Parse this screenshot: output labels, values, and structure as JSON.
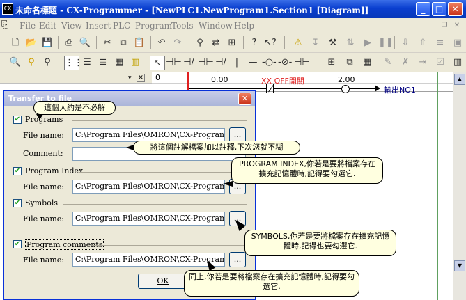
{
  "window": {
    "title": "未命名標題 - CX-Programmer - [NewPLC1.NewProgram1.Section1 [Diagram]]",
    "min": "_",
    "max": "□",
    "close": "✕"
  },
  "menu": [
    "File",
    "Edit",
    "View",
    "Insert",
    "PLC",
    "Program",
    "Tools",
    "Window",
    "Help"
  ],
  "toolbar1_icons": [
    "new-icon",
    "open-icon",
    "save-icon",
    "print-icon",
    "print-preview-icon",
    "cut-icon",
    "copy-icon",
    "paste-icon",
    "undo-icon",
    "redo-icon",
    "find-icon",
    "replace-icon",
    "cross-reference-icon",
    "help-icon",
    "context-help-icon",
    "warning-icon",
    "rung-icon",
    "compile-icon",
    "stop-icon",
    "pause-icon",
    "monitor-icon"
  ],
  "ladder": {
    "address_left": "0.00",
    "contact_label": "XX OFF開關",
    "address_right": "2.00",
    "coil_label": "輸出NO1"
  },
  "dialog": {
    "title": "Transfer to file",
    "close": "✕",
    "sections": [
      {
        "label": "Programs",
        "checked": true,
        "path": "C:\\Program Files\\OMRON\\CX-Programmer\\N",
        "browse": "..."
      },
      {
        "label": "Program Index",
        "checked": true,
        "path": "C:\\Program Files\\OMRON\\CX-Programmer\\P",
        "browse": "..."
      },
      {
        "label": "Symbols",
        "checked": true,
        "path": "C:\\Program Files\\OMRON\\CX-Programmer\\S",
        "browse": "..."
      },
      {
        "label": "Program comments",
        "checked": true,
        "path": "C:\\Program Files\\OMRON\\CX-Programmer\\C",
        "browse": "..."
      }
    ],
    "file_name_label": "File name:",
    "comment_label": "Comment:",
    "comment_value": "",
    "ok": "OK"
  },
  "callouts": {
    "c1": "這個大約是不必解",
    "c2": "將這個註解檔案加以註釋,下次您就不糊",
    "c3": "PROGRAM INDEX,你若是要將檔案存在擴充記憶體時,記得要勾選它.",
    "c4": "SYMBOLS,你若是要將檔案存在擴充記憶體時,記得也要勾選它.",
    "c5": "同上,你若是要將檔案存在擴充記憶體時,記得要勾選它."
  }
}
